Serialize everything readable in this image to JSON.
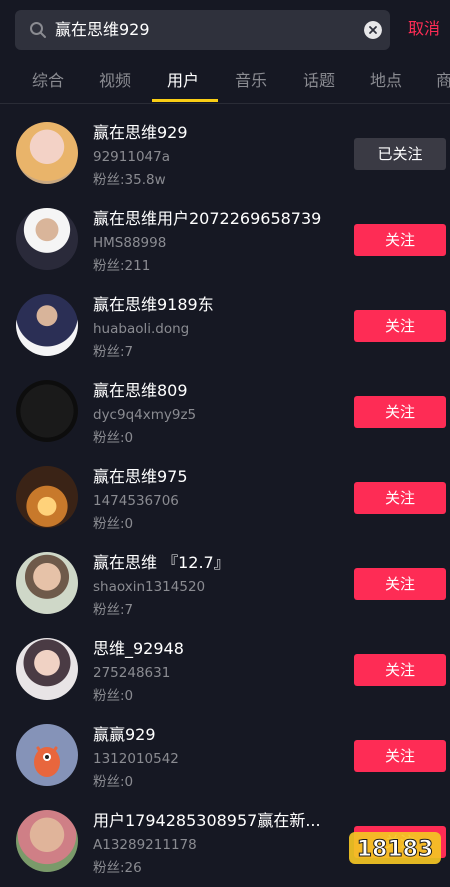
{
  "search": {
    "query": "赢在思维929",
    "cancel_label": "取消"
  },
  "tabs": [
    {
      "label": "综合"
    },
    {
      "label": "视频"
    },
    {
      "label": "用户"
    },
    {
      "label": "音乐"
    },
    {
      "label": "话题"
    },
    {
      "label": "地点"
    },
    {
      "label": "商"
    }
  ],
  "users": [
    {
      "name": "赢在思维929",
      "id": "92911047a",
      "fans": "粉丝:35.8w",
      "button": "已关注",
      "followed": true
    },
    {
      "name": "赢在思维用户2072269658739",
      "id": "HMS88998",
      "fans": "粉丝:211",
      "button": "关注",
      "followed": false
    },
    {
      "name": "赢在思维9189东",
      "id": "huabaoli.dong",
      "fans": "粉丝:7",
      "button": "关注",
      "followed": false
    },
    {
      "name": "赢在思维809",
      "id": "dyc9q4xmy9z5",
      "fans": "粉丝:0",
      "button": "关注",
      "followed": false
    },
    {
      "name": "赢在思维975",
      "id": "1474536706",
      "fans": "粉丝:0",
      "button": "关注",
      "followed": false
    },
    {
      "name": "赢在思维 『12.7』",
      "id": "shaoxin1314520",
      "fans": "粉丝:7",
      "button": "关注",
      "followed": false
    },
    {
      "name": "思维_92948",
      "id": "275248631",
      "fans": "粉丝:0",
      "button": "关注",
      "followed": false
    },
    {
      "name": "赢赢929",
      "id": "1312010542",
      "fans": "粉丝:0",
      "button": "关注",
      "followed": false
    },
    {
      "name": "用户1794285308957赢在新...",
      "id": "A13289211178",
      "fans": "粉丝:26",
      "button": "关注",
      "followed": false
    }
  ],
  "watermark": {
    "text": "18183"
  },
  "colors": {
    "background": "#161823",
    "accent": "#fe2c55",
    "tab_indicator": "#face15",
    "secondary_text": "#8a8b91"
  }
}
